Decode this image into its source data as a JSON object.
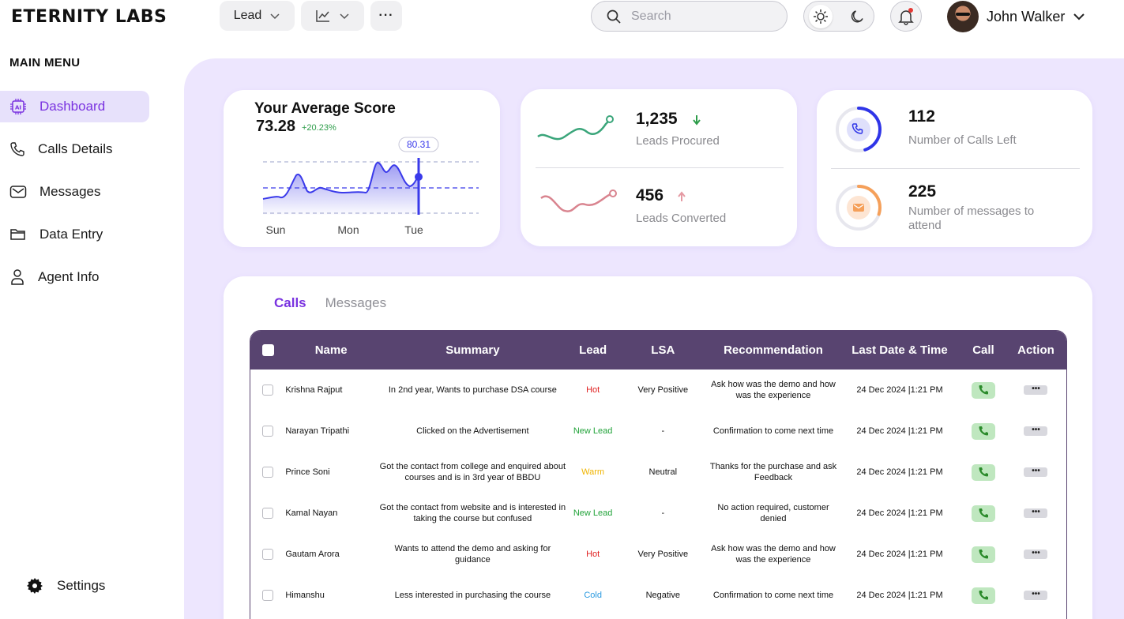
{
  "header": {
    "brand": "ETERNITY LABS",
    "lead_dropdown": "Lead",
    "more_label": "···",
    "search_placeholder": "Search",
    "user_name": "John Walker"
  },
  "sidebar": {
    "title": "MAIN MENU",
    "items": [
      {
        "label": "Dashboard",
        "icon": "ai-chip-icon",
        "active": true
      },
      {
        "label": "Calls Details",
        "icon": "phone-icon"
      },
      {
        "label": "Messages",
        "icon": "mail-icon"
      },
      {
        "label": "Data Entry",
        "icon": "folder-icon"
      },
      {
        "label": "Agent Info",
        "icon": "user-icon"
      }
    ],
    "settings_label": "Settings"
  },
  "score_card": {
    "title": "Your Average Score",
    "value": "73.28",
    "change": "+20.23%",
    "tooltip": "80.31",
    "chart_data": {
      "type": "area",
      "categories": [
        "Sun",
        "Mon",
        "Tue"
      ],
      "highlight": "80.31"
    }
  },
  "leads_card": {
    "procured_value": "1,235",
    "procured_label": "Leads Procured",
    "procured_trend": "down",
    "converted_value": "456",
    "converted_label": "Leads Converted",
    "converted_trend": "up",
    "colors": {
      "procured": "#3aa57a",
      "converted": "#d9848f"
    }
  },
  "calls_card": {
    "calls_value": "112",
    "calls_label": "Number of Calls Left",
    "calls_progress": 0.45,
    "messages_value": "225",
    "messages_label": "Number of messages to attend",
    "messages_progress": 0.3,
    "colors": {
      "calls": "#2f35e8",
      "messages": "#f5a05a"
    }
  },
  "tabs": {
    "calls": "Calls",
    "messages": "Messages"
  },
  "table": {
    "headers": {
      "name": "Name",
      "summary": "Summary",
      "lead": "Lead",
      "lsa": "LSA",
      "recommendation": "Recommendation",
      "date": "Last Date & Time",
      "call": "Call",
      "action": "Action"
    },
    "rows": [
      {
        "name": "Krishna Rajput",
        "summary": "In 2nd year, Wants to purchase DSA course",
        "lead": "Hot",
        "lead_color": "#e02020",
        "lsa": "Very Positive",
        "recommendation": "Ask how was the demo and how was the experience",
        "date": "24 Dec 2024 |1:21 PM"
      },
      {
        "name": "Narayan Tripathi",
        "summary": "Clicked on the Advertisement",
        "lead": "New Lead",
        "lead_color": "#22a33a",
        "lsa": "-",
        "recommendation": "Confirmation to come next time",
        "date": "24 Dec 2024 |1:21 PM"
      },
      {
        "name": "Prince Soni",
        "summary": "Got the contact from college and enquired about courses and is in 3rd year of BBDU",
        "lead": "Warm",
        "lead_color": "#f0b400",
        "lsa": "Neutral",
        "recommendation": "Thanks for the purchase and ask Feedback",
        "date": "24 Dec 2024 |1:21 PM"
      },
      {
        "name": "Kamal Nayan",
        "summary": "Got the contact from website and is interested in taking the course but confused",
        "lead": "New Lead",
        "lead_color": "#22a33a",
        "lsa": "-",
        "recommendation": "No action required, customer denied",
        "date": "24 Dec 2024 |1:21 PM"
      },
      {
        "name": "Gautam Arora",
        "summary": "Wants to attend the demo and asking for guidance",
        "lead": "Hot",
        "lead_color": "#e02020",
        "lsa": "Very Positive",
        "recommendation": "Ask how was the demo and how was the experience",
        "date": "24 Dec 2024 |1:21 PM"
      },
      {
        "name": "Himanshu",
        "summary": "Less interested in purchasing the course",
        "lead": "Cold",
        "lead_color": "#2a9ae0",
        "lsa": "Negative",
        "recommendation": "Confirmation to come next time",
        "date": "24 Dec 2024 |1:21 PM"
      }
    ]
  }
}
